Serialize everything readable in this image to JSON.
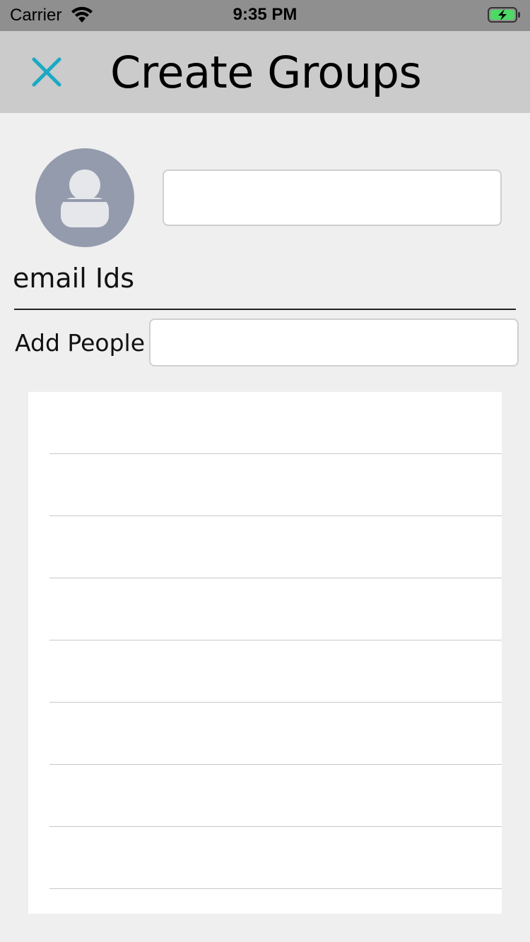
{
  "status_bar": {
    "carrier": "Carrier",
    "time": "9:35 PM",
    "wifi_icon": "wifi-icon",
    "battery_icon": "battery-charging-icon",
    "battery_color": "#4cd964"
  },
  "nav": {
    "title": "Create Groups",
    "close_icon": "close-icon",
    "accent_color": "#1ba9c4"
  },
  "group": {
    "avatar_icon": "person-placeholder-icon",
    "name_value": "",
    "name_placeholder": ""
  },
  "email_ids_label": "email Ids",
  "add_people": {
    "label": "Add People",
    "value": "",
    "placeholder": ""
  },
  "people_list": {
    "rows": [
      "",
      "",
      "",
      "",
      "",
      "",
      "",
      ""
    ]
  }
}
